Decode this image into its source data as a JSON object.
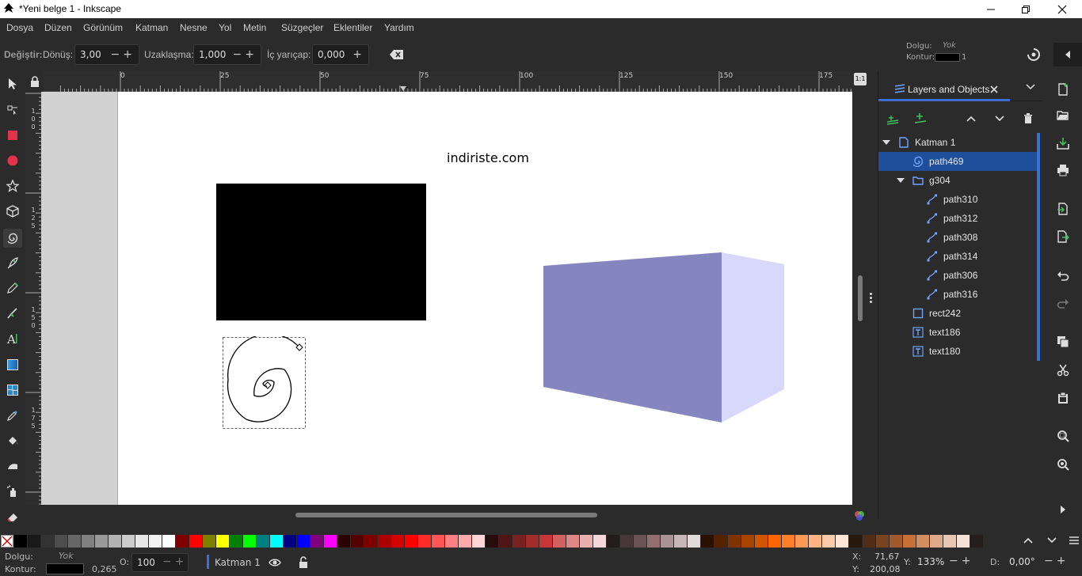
{
  "window": {
    "title": "*Yeni belge 1 - Inkscape"
  },
  "menu": [
    "Dosya",
    "Düzen",
    "Görünüm",
    "Katman",
    "Nesne",
    "Yol",
    "Metin",
    "Süzgeçler",
    "Eklentiler",
    "Yardım"
  ],
  "toolcontrols": {
    "mode_label": "Değiştir:",
    "turns_label": "Dönüş:",
    "turns_value": "3,00",
    "divergence_label": "Uzaklaşma:",
    "divergence_value": "1,000",
    "inner_radius_label": "İç yarıçap:",
    "inner_radius_value": "0,000"
  },
  "style_indicator": {
    "fill_label": "Dolgu:",
    "fill_value": "Yok",
    "stroke_label": "Kontur:",
    "stroke_width": "1"
  },
  "ruler": {
    "ticks": [
      "0",
      "25",
      "50",
      "75",
      "100",
      "125",
      "150",
      "175"
    ],
    "left_ticks": [
      "100",
      "125",
      "150",
      "175"
    ]
  },
  "canvas": {
    "text": "indiriste.com"
  },
  "panel": {
    "tab_label": "Layers and Objects",
    "items": [
      {
        "label": "Katman 1",
        "type": "layer"
      },
      {
        "label": "path469",
        "type": "spiral"
      },
      {
        "label": "g304",
        "type": "group"
      },
      {
        "label": "path310",
        "type": "path"
      },
      {
        "label": "path312",
        "type": "path"
      },
      {
        "label": "path308",
        "type": "path"
      },
      {
        "label": "path314",
        "type": "path"
      },
      {
        "label": "path306",
        "type": "path"
      },
      {
        "label": "path316",
        "type": "path"
      },
      {
        "label": "rect242",
        "type": "rect"
      },
      {
        "label": "text186",
        "type": "text"
      },
      {
        "label": "text180",
        "type": "text"
      }
    ]
  },
  "status": {
    "fill_label": "Dolgu:",
    "fill_value": "Yok",
    "stroke_label": "Kontur:",
    "stroke_value": "0,265",
    "opacity_label": "O:",
    "opacity_value": "100",
    "layer": "Katman 1",
    "x_label": "X:",
    "x_value": "71,67",
    "y_label": "Y:",
    "y_value": "200,08",
    "zoom_label": "Y:",
    "zoom_value": "133%",
    "rotation_label": "D:",
    "rotation_value": "0,00°"
  },
  "colors": {
    "accent": "#3b6fd6",
    "selected_row": "#1f4f9a",
    "box_front": "#8585c0",
    "box_side": "#d8d8fb",
    "palette": [
      "#000000",
      "#1a1a1a",
      "#333333",
      "#4d4d4d",
      "#666666",
      "#808080",
      "#999999",
      "#b3b3b3",
      "#cccccc",
      "#e6e6e6",
      "#f2f2f2",
      "#ffffff",
      "#800000",
      "#ff0000",
      "#808000",
      "#ffff00",
      "#008000",
      "#00ff00",
      "#008080",
      "#00ffff",
      "#000080",
      "#0000ff",
      "#800080",
      "#ff00ff",
      "#2b0000",
      "#550000",
      "#800000",
      "#aa0000",
      "#d40000",
      "#ff0000",
      "#ff2a2a",
      "#ff5555",
      "#ff8080",
      "#ffaaaa",
      "#ffd5d5",
      "#280b0b",
      "#501616",
      "#782121",
      "#a02c2c",
      "#c83737",
      "#d35f5f",
      "#de8787",
      "#e9afaf",
      "#f4d7d7",
      "#241c1c",
      "#483737",
      "#6c5353",
      "#916f6f",
      "#ac9393",
      "#c8b7b7",
      "#e3dbdb",
      "#2b1100",
      "#552200",
      "#803300",
      "#aa4400",
      "#d45500",
      "#ff6600",
      "#ff7f2a",
      "#ff9955",
      "#ffb380",
      "#ffccaa",
      "#ffe6d5",
      "#28170b",
      "#502d16",
      "#784421",
      "#a05a2c",
      "#c87137",
      "#d38d5f",
      "#deaa87",
      "#e9c6af",
      "#f4e3d7",
      "#241f1c"
    ]
  }
}
